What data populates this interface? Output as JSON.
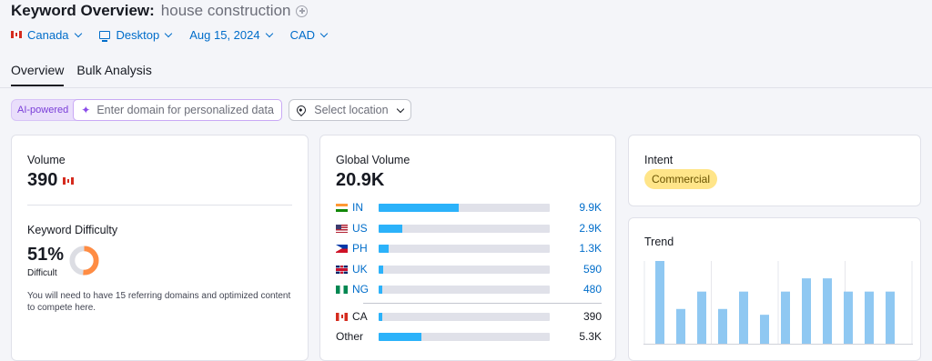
{
  "header": {
    "title": "Keyword Overview:",
    "keyword": "house construction"
  },
  "filters": {
    "country": "Canada",
    "device": "Desktop",
    "date": "Aug 15, 2024",
    "currency": "CAD"
  },
  "tabs": [
    {
      "label": "Overview",
      "active": true
    },
    {
      "label": "Bulk Analysis",
      "active": false
    }
  ],
  "ai": {
    "badge": "AI-powered",
    "placeholder": "Enter domain for personalized data",
    "location_placeholder": "Select location"
  },
  "volume": {
    "label": "Volume",
    "value": "390"
  },
  "keyword_difficulty": {
    "label": "Keyword Difficulty",
    "value": "51%",
    "percent": 51,
    "level": "Difficult",
    "note": "You will need to have 15 referring domains and optimized content to compete here.",
    "color": "#ff8c43"
  },
  "global_volume": {
    "label": "Global Volume",
    "value": "20.9K",
    "countries": [
      {
        "code": "IN",
        "value": "9.9K",
        "fraction": 0.47,
        "flag": "flag-in"
      },
      {
        "code": "US",
        "value": "2.9K",
        "fraction": 0.14,
        "flag": "flag-us"
      },
      {
        "code": "PH",
        "value": "1.3K",
        "fraction": 0.06,
        "flag": "flag-ph"
      },
      {
        "code": "UK",
        "value": "590",
        "fraction": 0.028,
        "flag": "flag-uk"
      },
      {
        "code": "NG",
        "value": "480",
        "fraction": 0.023,
        "flag": "flag-ng"
      }
    ],
    "local": {
      "code": "CA",
      "value": "390",
      "fraction": 0.019,
      "flag": "flag-ca2"
    },
    "other": {
      "label": "Other",
      "value": "5.3K",
      "fraction": 0.25
    }
  },
  "intent": {
    "label": "Intent",
    "value": "Commercial"
  },
  "trend": {
    "label": "Trend",
    "chart_data": {
      "type": "bar",
      "values": [
        1.0,
        0.42,
        0.63,
        0.42,
        0.63,
        0.35,
        0.63,
        0.79,
        0.79,
        0.63,
        0.63,
        0.63
      ],
      "color": "#8fc8f2"
    }
  }
}
